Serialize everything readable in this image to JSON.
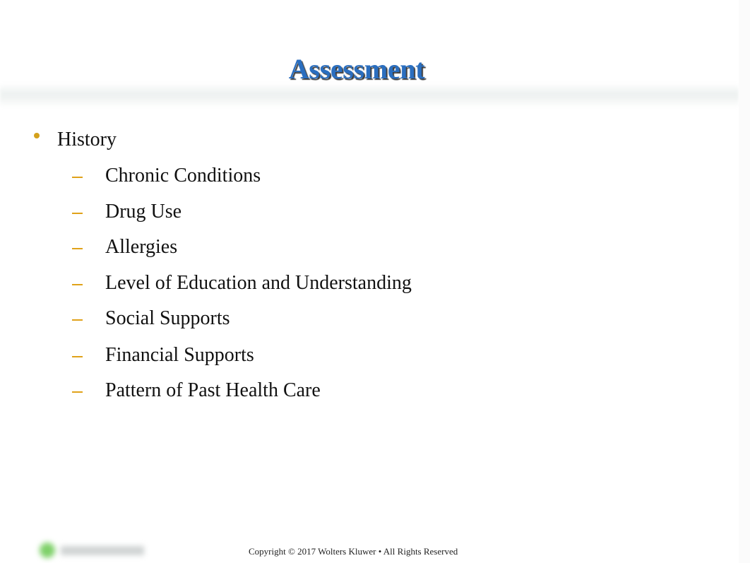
{
  "slide": {
    "title": "Assessment",
    "bullets": [
      {
        "label": "History",
        "sub": [
          "Chronic Conditions",
          "Drug Use",
          "Allergies",
          "Level of Education and Understanding",
          "Social Supports",
          "Financial Supports",
          "Pattern of Past Health Care"
        ]
      }
    ],
    "sub_marker": "–",
    "footer": "Copyright © 2017 Wolters Kluwer • All Rights Reserved",
    "logo": "Wolters Kluwer logo (blurred)"
  },
  "colors": {
    "title": "#2a6ebf",
    "bullet_marker": "#d4a11c",
    "dash_marker": "#e0a21a",
    "logo_green": "#7fd16a"
  }
}
